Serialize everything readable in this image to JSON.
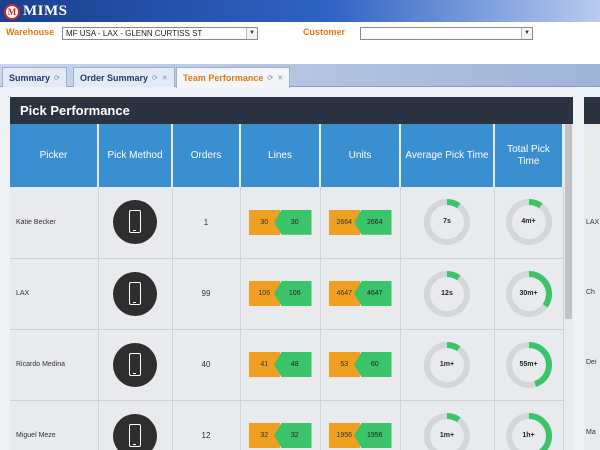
{
  "app": {
    "logo_text": "MIMS",
    "logo_mark": "M"
  },
  "filters": {
    "warehouse_label": "Warehouse",
    "warehouse_value": "MF USA - LAX - GLENN CURTISS ST",
    "customer_label": "Customer",
    "customer_value": ""
  },
  "tabs": [
    {
      "label": "Summary",
      "active": false,
      "icons": [
        "refresh-icon"
      ]
    },
    {
      "label": "Order Summary",
      "active": false,
      "icons": [
        "refresh-icon",
        "close-icon"
      ]
    },
    {
      "label": "Team Performance",
      "active": true,
      "icons": [
        "refresh-icon",
        "close-icon"
      ]
    }
  ],
  "panel": {
    "title": "Pick Performance",
    "columns": [
      "Picker",
      "Pick Method",
      "Orders",
      "Lines",
      "Units",
      "Average Pick Time",
      "Total Pick Time"
    ],
    "rows": [
      {
        "picker": "Katie Becker",
        "orders": "1",
        "lines_a": "30",
        "lines_b": "30",
        "units_a": "2664",
        "units_b": "2664",
        "avg": "7s",
        "avg_frac": 0.1,
        "total": "4m+",
        "total_frac": 0.1
      },
      {
        "picker": "LAX",
        "orders": "99",
        "lines_a": "106",
        "lines_b": "106",
        "units_a": "4647",
        "units_b": "4647",
        "avg": "12s",
        "avg_frac": 0.1,
        "total": "30m+",
        "total_frac": 0.35
      },
      {
        "picker": "Ricardo Medina",
        "orders": "40",
        "lines_a": "41",
        "lines_b": "48",
        "units_a": "53",
        "units_b": "60",
        "avg": "1m+",
        "avg_frac": 0.1,
        "total": "55m+",
        "total_frac": 0.45
      },
      {
        "picker": "Miguel Meze",
        "orders": "12",
        "lines_a": "32",
        "lines_b": "32",
        "units_a": "1956",
        "units_b": "1956",
        "avg": "1m+",
        "avg_frac": 0.1,
        "total": "1h+",
        "total_frac": 0.4
      }
    ],
    "pick_method_icon": "mobile-phone-icon"
  },
  "panel2_cells": [
    "LAX",
    "Ch",
    "Dei",
    "Ma"
  ],
  "colors": {
    "header_blue": "#3a8fd0",
    "panel_dark": "#2c3340",
    "orange": "#f0a020",
    "green": "#3cc46a",
    "ring_green": "#3cc46a"
  }
}
